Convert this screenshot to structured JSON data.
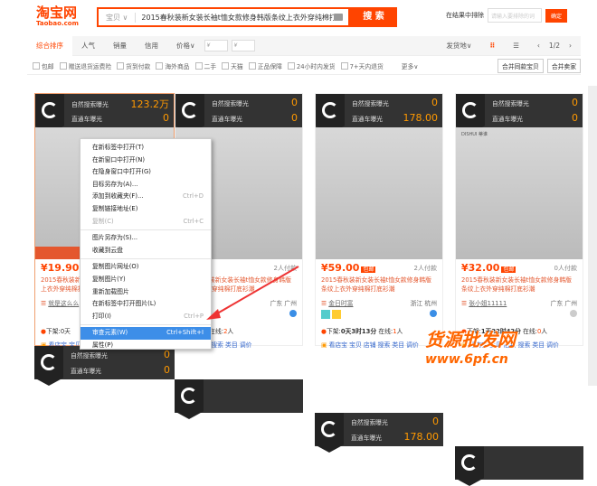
{
  "header": {
    "logo_cn": "淘宝网",
    "logo_en": "Taobao.com",
    "search_category": "宝贝 ∨",
    "search_query": "2015春秋装新女装长袖t恤女款修身韩版条纹上衣外穿纯棉打底衫潮",
    "search_button": "搜 索",
    "exclude_label": "在结果中排除",
    "exclude_placeholder": "请输入要排除的词",
    "exclude_ok": "确定"
  },
  "sort": {
    "tabs": [
      "综合排序",
      "人气",
      "销量",
      "信用",
      "价格∨"
    ],
    "price_min": "¥",
    "price_max": "¥",
    "ship_from": "发货地∨",
    "page": "1/2"
  },
  "filters": {
    "items": [
      "包邮",
      "赠送退货运费险",
      "货到付款",
      "海外商品",
      "二手",
      "天猫",
      "正品保障",
      "24小时内发货",
      "7+天内退货"
    ],
    "more": "更多∨",
    "merge_same": "合并同款宝贝",
    "merge_seller": "合并卖家"
  },
  "cards": [
    {
      "natural_label": "自然搜索曝光",
      "natural_value": "123.2万",
      "ztc_label": "直通车曝光",
      "ztc_value": "0",
      "price": "¥19.90",
      "badge": "包邮",
      "paid": "",
      "title": "2015春秋装新女装长袖t恤女款修身韩版条纹上衣外穿纯棉打底衫潮",
      "shop": "就是这么么",
      "location": "",
      "timer_prefix": "下架:0天",
      "timer_time": "",
      "online": "",
      "links": "看店宝 宝贝 店铺 搜索 类目 调价",
      "overlay": "找同款"
    },
    {
      "natural_label": "自然搜索曝光",
      "natural_value": "0",
      "ztc_label": "直通车曝光",
      "ztc_value": "0",
      "price": "0",
      "badge": "包邮",
      "paid": "2人付款",
      "title": "2015春秋装新女装长袖t恤女款修身韩版条纹上衣外穿纯棉打底衫潮",
      "shop": "3033",
      "location": "广东 广州",
      "timer_prefix": "",
      "timer_time": "时14分",
      "online_label": "在线:",
      "online": "2",
      "online_unit": "人",
      "links": "贝 店铺 搜索 类目 调价"
    },
    {
      "natural_label": "自然搜索曝光",
      "natural_value": "0",
      "ztc_label": "直通车曝光",
      "ztc_value": "178.00",
      "price": "¥59.00",
      "badge": "包邮",
      "paid": "2人付款",
      "title": "2015春秋装新女装长袖t恤女款修身韩版条纹上衣外穿纯棉打底衫潮",
      "shop": "金日时富",
      "location": "浙江 杭州",
      "timer_prefix": "下架:",
      "timer_time": "0天3时13分",
      "online_label": "在线:",
      "online": "1",
      "online_unit": "人",
      "links": "看店宝 宝贝 店铺 搜索 类目 调价"
    },
    {
      "natural_label": "自然搜索曝光",
      "natural_value": "0",
      "ztc_label": "直通车曝光",
      "ztc_value": "0",
      "price": "¥32.00",
      "badge": "包邮",
      "paid": "0人付款",
      "title": "2015春秋装新女装长袖t恤女款修身韩版条纹上衣外穿纯棉打底衫潮",
      "shop": "张小姐11111",
      "location": "广东 广州",
      "timer_prefix": "下架:",
      "timer_time": "1天22时42分",
      "online_label": "在线:",
      "online": "0",
      "online_unit": "人",
      "links": "看店宝 宝贝 店铺 搜索 类目 调价",
      "brand": "DISHUI 蒂谁"
    }
  ],
  "context_menu": [
    {
      "label": "在新标签中打开(T)"
    },
    {
      "label": "在新窗口中打开(N)"
    },
    {
      "label": "在隐身窗口中打开(G)"
    },
    {
      "label": "目标另存为(A)..."
    },
    {
      "label": "添加到收藏夹(F)...",
      "key": "Ctrl+D"
    },
    {
      "label": "复制链接地址(E)"
    },
    {
      "label": "复制(C)",
      "key": "Ctrl+C",
      "disabled": true
    },
    {
      "label": "图片另存为(S)...",
      "sep": true
    },
    {
      "label": "收藏到云盘"
    },
    {
      "label": "复制图片网址(O)",
      "sep": true
    },
    {
      "label": "复制图片(Y)"
    },
    {
      "label": "重新加载图片"
    },
    {
      "label": "在新标签中打开图片(L)"
    },
    {
      "label": "打印(I)",
      "key": "Ctrl+P"
    },
    {
      "label": "审查元素(W)",
      "key": "Ctrl+Shift+I",
      "highlighted": true,
      "sep": true
    },
    {
      "label": "属性(P)"
    }
  ],
  "watermark": {
    "line1": "货源批发网",
    "line2": "www.6pf.cn"
  },
  "colors": {
    "accent": "#ff4400",
    "highlight": "#3d8ee8",
    "header_dark": "#333333",
    "value": "#ff9900"
  }
}
